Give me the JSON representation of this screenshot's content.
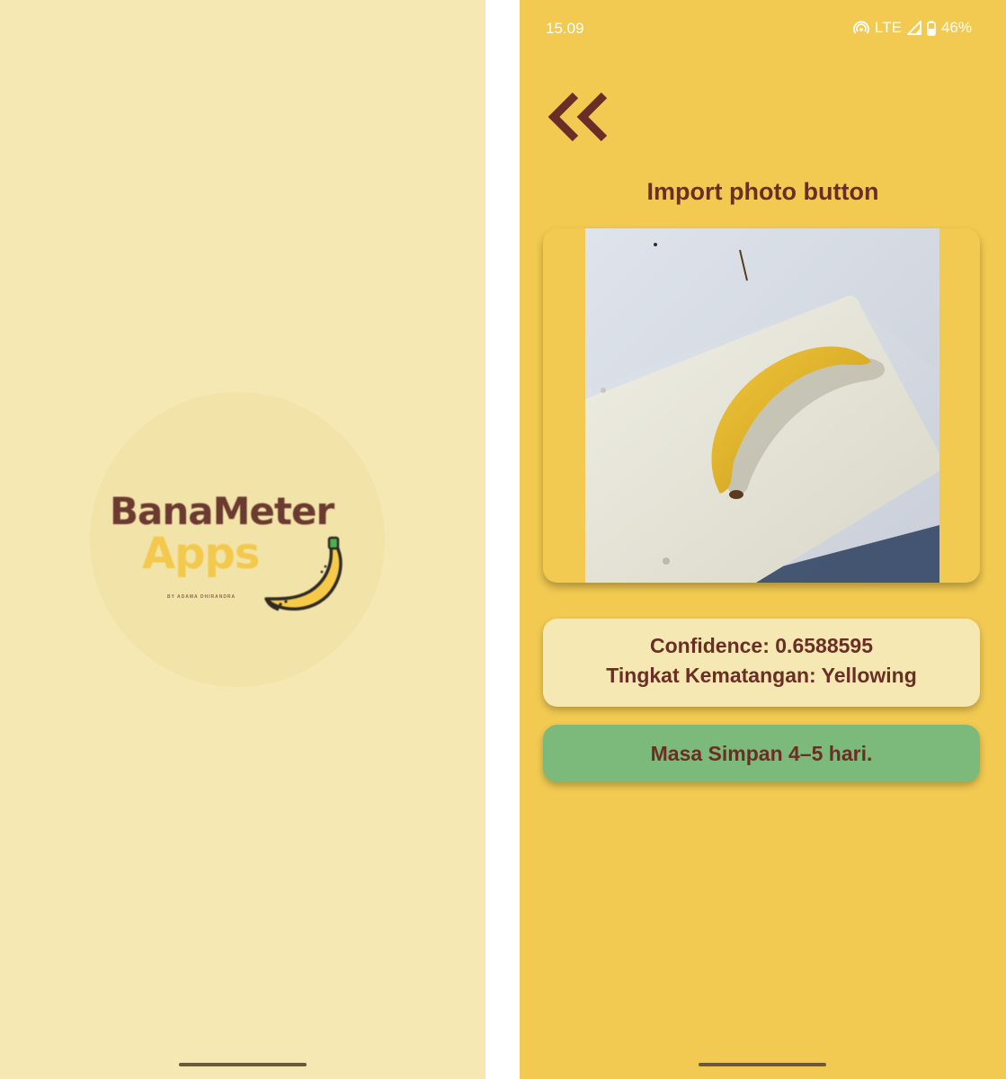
{
  "splash": {
    "brand_line1": "BanaMeter",
    "brand_line2": "Apps",
    "brand_tagline": "BY ADAMA DHIRANDRA"
  },
  "status_bar": {
    "time": "15.09",
    "network": "LTE",
    "battery": "46%",
    "icons": [
      "hotspot-icon",
      "signal-icon",
      "battery-icon"
    ]
  },
  "result_screen": {
    "back_icon": "double-chevron-left-icon",
    "title": "Import photo button",
    "confidence_line": "Confidence: 0.6588595",
    "ripeness_line": "Tingkat Kematangan: Yellowing",
    "shelf_life": "Masa Simpan 4–5 hari."
  },
  "colors": {
    "splash_bg": "#f5e8b2",
    "screen_bg": "#f2ca51",
    "text_brown": "#6b2e25",
    "card_cream": "#f5e8b2",
    "card_green": "#7bba7a"
  }
}
